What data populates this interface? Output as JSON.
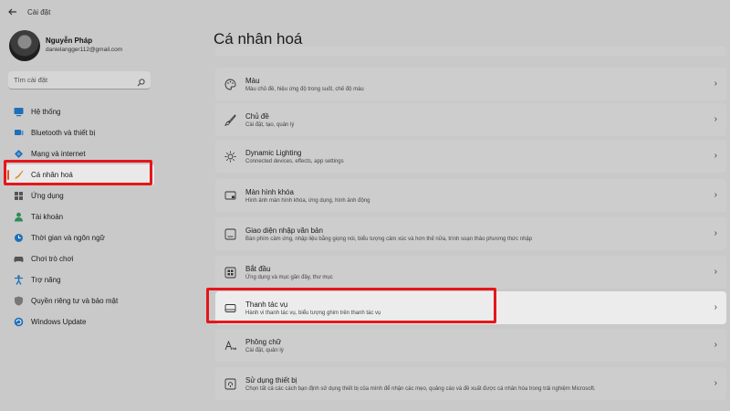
{
  "app": {
    "title": "Cài đặt",
    "back_icon": "back-arrow-icon"
  },
  "user": {
    "name": "Nguyễn Pháp",
    "email": "danielangger112@gmail.com"
  },
  "search": {
    "placeholder": "Tìm cài đặt"
  },
  "sidebar": {
    "items": [
      {
        "label": "Hệ thống",
        "icon": "monitor-icon",
        "color": "#1f6fb8"
      },
      {
        "label": "Bluetooth và thiết bị",
        "icon": "bluetooth-icon",
        "color": "#1f6fb8"
      },
      {
        "label": "Mạng và internet",
        "icon": "wifi-icon",
        "color": "#1f6fb8"
      },
      {
        "label": "Cá nhân hoá",
        "icon": "brush-icon",
        "color": "#d97a2b",
        "active": true
      },
      {
        "label": "Ứng dụng",
        "icon": "apps-icon",
        "color": "#555555"
      },
      {
        "label": "Tài khoản",
        "icon": "person-icon",
        "color": "#2e8b57"
      },
      {
        "label": "Thời gian và ngôn ngữ",
        "icon": "globe-clock-icon",
        "color": "#1f6fb8"
      },
      {
        "label": "Chơi trò chơi",
        "icon": "gamepad-icon",
        "color": "#555555"
      },
      {
        "label": "Trợ năng",
        "icon": "accessibility-icon",
        "color": "#1f6fb8"
      },
      {
        "label": "Quyền riêng tư và bảo mật",
        "icon": "shield-icon",
        "color": "#666666"
      },
      {
        "label": "Windows Update",
        "icon": "update-icon",
        "color": "#1f6fb8"
      }
    ]
  },
  "main": {
    "title": "Cá nhân hoá",
    "rows": [
      {
        "title": "Màu",
        "sub": "Màu chủ đề, hiệu ứng độ trong suốt, chế độ màu",
        "icon": "palette-icon"
      },
      {
        "title": "Chủ đề",
        "sub": "Cài đặt, tạo, quản lý",
        "icon": "brush-icon"
      },
      {
        "title": "Dynamic Lighting",
        "sub": "Connected devices, effects, app settings",
        "icon": "sun-icon"
      },
      {
        "title": "Màn hình khóa",
        "sub": "Hình ảnh màn hình khóa, ứng dụng, hình ảnh động",
        "icon": "lockscreen-icon"
      },
      {
        "title": "Giao diện nhập văn bản",
        "sub": "Bàn phím cảm ứng, nhập liệu bằng giọng nói, biểu tượng cảm xúc và hơn thế nữa, trình soạn thảo phương thức nhập",
        "icon": "keyboard-icon"
      },
      {
        "title": "Bắt đầu",
        "sub": "Ứng dụng và mục gần đây, thư mục",
        "icon": "start-icon"
      },
      {
        "title": "Thanh tác vụ",
        "sub": "Hành vi thanh tác vụ, biểu tượng ghim trên thanh tác vụ",
        "icon": "taskbar-icon",
        "highlighted": true
      },
      {
        "title": "Phông chữ",
        "sub": "Cài đặt, quản lý",
        "icon": "font-icon"
      },
      {
        "title": "Sử dụng thiết bị",
        "sub": "Chọn tất cả các cách bạn định sử dụng thiết bị của mình để nhận các mẹo, quảng cáo và đề xuất được cá nhân hóa trong trải nghiệm Microsoft.",
        "icon": "device-usage-icon"
      }
    ]
  },
  "colors": {
    "highlight": "#e5161b",
    "accent": "#d35a1e",
    "background": "#c9c9c9"
  }
}
